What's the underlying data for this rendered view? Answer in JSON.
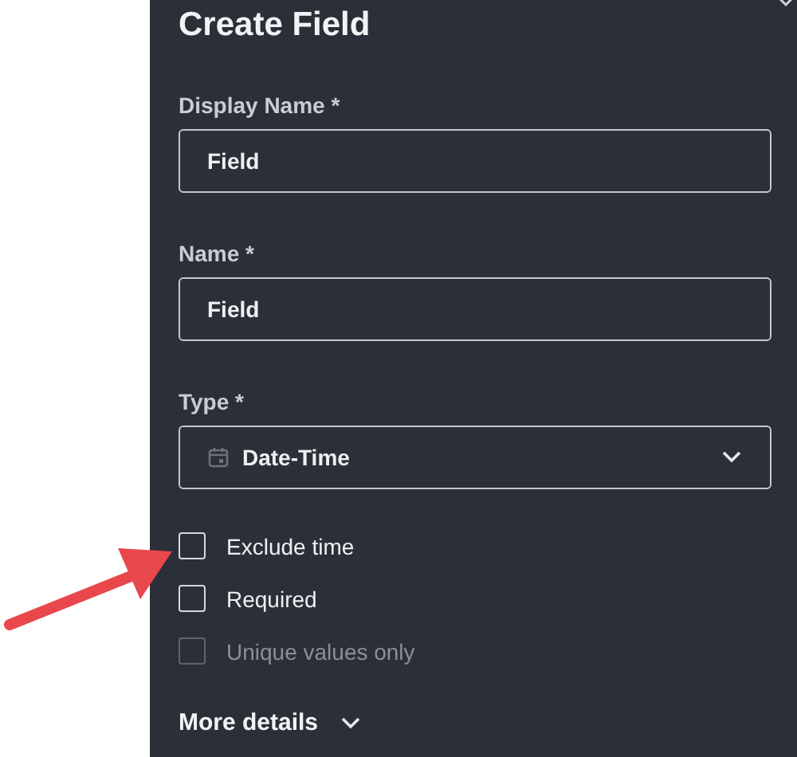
{
  "panel": {
    "title": "Create Field"
  },
  "fields": [
    {
      "kind": "text",
      "label": "Display Name *",
      "value": "Field"
    },
    {
      "kind": "text",
      "label": "Name *",
      "value": "Field"
    },
    {
      "kind": "select",
      "label": "Type *",
      "value": "Date-Time"
    }
  ],
  "options": [
    {
      "label": "Exclude time",
      "checked": false,
      "disabled": false
    },
    {
      "label": "Required",
      "checked": false,
      "disabled": false
    },
    {
      "label": "Unique values only",
      "checked": false,
      "disabled": true
    }
  ],
  "more_details": {
    "label": "More details",
    "expanded": false
  }
}
